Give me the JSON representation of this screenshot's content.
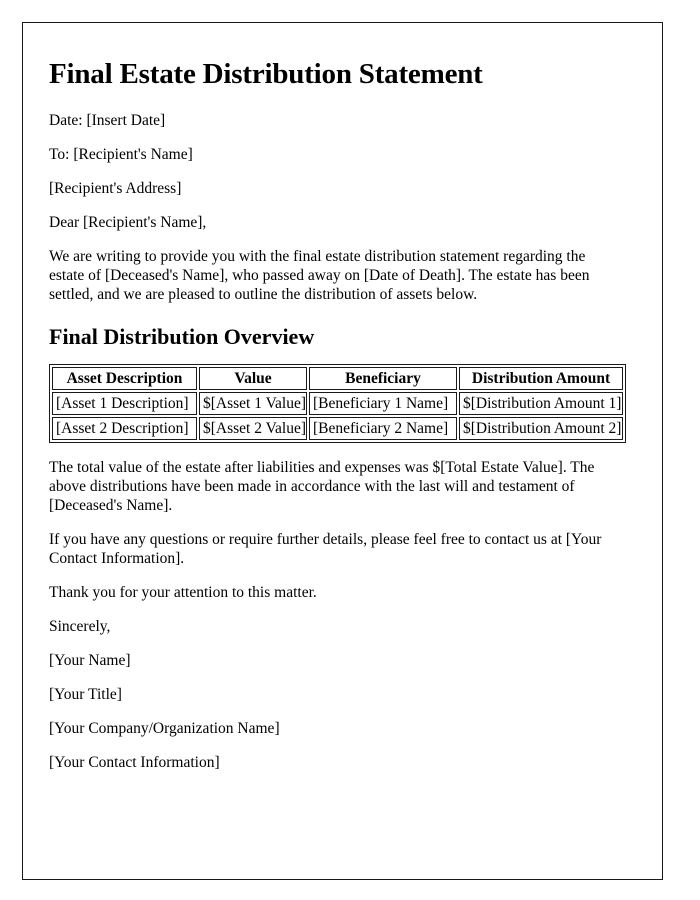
{
  "document": {
    "title": "Final Estate Distribution Statement",
    "date_line": "Date: [Insert Date]",
    "to_line": "To: [Recipient's Name]",
    "address_line": "[Recipient's Address]",
    "salutation": "Dear [Recipient's Name],",
    "intro_paragraph": "We are writing to provide you with the final estate distribution statement regarding the estate of [Deceased's Name], who passed away on [Date of Death]. The estate has been settled, and we are pleased to outline the distribution of assets below.",
    "section_heading": "Final Distribution Overview",
    "table": {
      "headers": [
        "Asset Description",
        "Value",
        "Beneficiary",
        "Distribution Amount"
      ],
      "rows": [
        [
          "[Asset 1 Description]",
          "$[Asset 1 Value]",
          "[Beneficiary 1 Name]",
          "$[Distribution Amount 1]"
        ],
        [
          "[Asset 2 Description]",
          "$[Asset 2 Value]",
          "[Beneficiary 2 Name]",
          "$[Distribution Amount 2]"
        ]
      ]
    },
    "total_paragraph": "The total value of the estate after liabilities and expenses was $[Total Estate Value]. The above distributions have been made in accordance with the last will and testament of [Deceased's Name].",
    "contact_paragraph": "If you have any questions or require further details, please feel free to contact us at [Your Contact Information].",
    "thanks_line": "Thank you for your attention to this matter.",
    "closing": "Sincerely,",
    "signature": {
      "name": "[Your Name]",
      "title": "[Your Title]",
      "company": "[Your Company/Organization Name]",
      "contact": "[Your Contact Information]"
    }
  }
}
